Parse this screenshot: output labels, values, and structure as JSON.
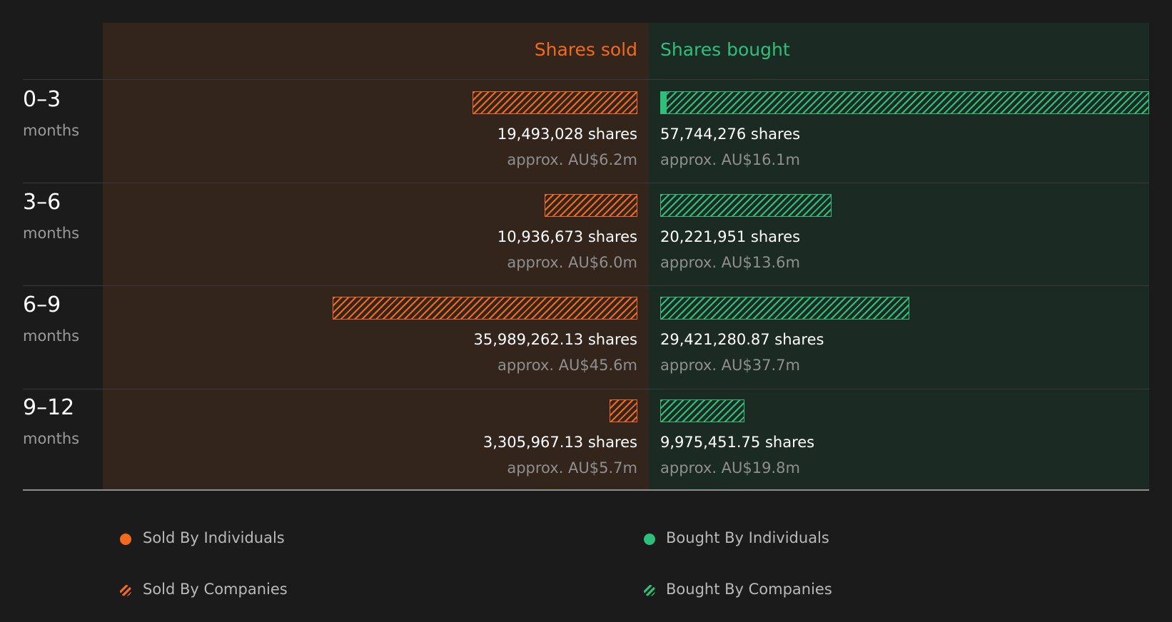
{
  "colors": {
    "background": "#1b1b1b",
    "sold_panel": "#33241c",
    "bought_panel": "#1b2b24",
    "sold": "#f26a1b",
    "bought": "#2ec07b"
  },
  "chart_data": {
    "type": "bar",
    "orientation": "horizontal-diverging",
    "columns": {
      "sold": "Shares sold",
      "bought": "Shares bought"
    },
    "periods": [
      {
        "label": "0–3",
        "unit": "months",
        "sold": {
          "shares_value": 19493028,
          "shares_text": "19,493,028 shares",
          "approx_text": "approx. AU$6.2m",
          "individuals_value": 0
        },
        "bought": {
          "shares_value": 57744276,
          "shares_text": "57,744,276 shares",
          "approx_text": "approx. AU$16.1m",
          "individuals_value": 640000
        }
      },
      {
        "label": "3–6",
        "unit": "months",
        "sold": {
          "shares_value": 10936673,
          "shares_text": "10,936,673 shares",
          "approx_text": "approx. AU$6.0m",
          "individuals_value": 0
        },
        "bought": {
          "shares_value": 20221951,
          "shares_text": "20,221,951 shares",
          "approx_text": "approx. AU$13.6m",
          "individuals_value": 0
        }
      },
      {
        "label": "6–9",
        "unit": "months",
        "sold": {
          "shares_value": 35989262.13,
          "shares_text": "35,989,262.13 shares",
          "approx_text": "approx. AU$45.6m",
          "individuals_value": 0
        },
        "bought": {
          "shares_value": 29421280.87,
          "shares_text": "29,421,280.87 shares",
          "approx_text": "approx. AU$37.7m",
          "individuals_value": 0
        }
      },
      {
        "label": "9–12",
        "unit": "months",
        "sold": {
          "shares_value": 3305967.13,
          "shares_text": "3,305,967.13 shares",
          "approx_text": "approx. AU$5.7m",
          "individuals_value": 0
        },
        "bought": {
          "shares_value": 9975451.75,
          "shares_text": "9,975,451.75 shares",
          "approx_text": "approx. AU$19.8m",
          "individuals_value": 0
        }
      }
    ],
    "legend": [
      {
        "label": "Sold By Individuals",
        "style": "solid",
        "color": "#f26a1b"
      },
      {
        "label": "Bought By Individuals",
        "style": "solid",
        "color": "#2ec07b"
      },
      {
        "label": "Sold By Companies",
        "style": "hatched",
        "color": "#f26a1b"
      },
      {
        "label": "Bought By Companies",
        "style": "hatched",
        "color": "#2ec07b"
      }
    ]
  }
}
